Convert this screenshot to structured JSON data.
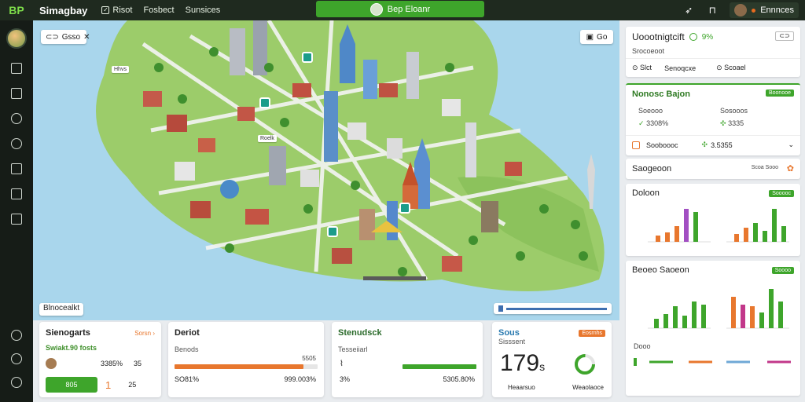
{
  "app": {
    "title": "Simagbay",
    "logo_text": "BP"
  },
  "topnav": [
    {
      "label": "Risot",
      "icon": "check-square-icon"
    },
    {
      "label": "Fosbect"
    },
    {
      "label": "Sunsices"
    }
  ],
  "header_button": {
    "label": "Bep Eloanr"
  },
  "user": {
    "name": "Ennnces"
  },
  "map": {
    "tool_chip": "Gsso",
    "top_right_chip": "Go",
    "bottom_left_chip": "Blnocealkt",
    "labels": [
      "Hhvs",
      "Roelk"
    ],
    "water_color": "#a9d6ec",
    "land_color": "#9ccc6a"
  },
  "cards": {
    "c1": {
      "title": "Sienogarts",
      "link": "Sorsn",
      "sub": "Swiakt.90 fosts",
      "row1_val": "3385%",
      "row1_val2": "35",
      "btn_label": "805",
      "row2_val": "1",
      "row2_val2": "25"
    },
    "c2": {
      "title": "Deriot",
      "sub": "Benods",
      "bar_label": "5505",
      "left": "SO81%",
      "right": "999.003%",
      "bar_fill": 0.9,
      "accent": "#e8772e"
    },
    "c3": {
      "title": "Stenudsck",
      "sub": "Tesseiiarl",
      "left": "3%",
      "right": "5305.80%",
      "bar_fill": 1.0,
      "accent": "#3ea52b"
    },
    "c4": {
      "title": "Sous",
      "sub": "Sisssent",
      "badge": "Eosrnhs",
      "big": "179",
      "unit": "s",
      "foot_left": "Heaarsuo",
      "foot_right": "Weaolaoce"
    }
  },
  "right": {
    "r1": {
      "title": "Uoootnigtcift",
      "pct": "9%",
      "sub": "Srocoeoot",
      "tab1": "Slct",
      "tab1_val": "Senoqcxe",
      "tab2": "Scoael"
    },
    "r2": {
      "title": "Nonosc Bajon",
      "badge": "Boonooe",
      "k1": "Soeooo",
      "k1v": "3308%",
      "k2": "Sosooos",
      "k2v": "3335",
      "row_title": "Sooboooc",
      "row_val": "3.5355"
    },
    "r3": {
      "title": "Saogeoon",
      "extra": "Scoa Sooo"
    },
    "r4": {
      "title": "Doloon",
      "badge": "Sooooc"
    },
    "r5": {
      "title": "Beoeo Saoeon",
      "badge": "Soooo",
      "foot": "Dooo"
    }
  }
}
